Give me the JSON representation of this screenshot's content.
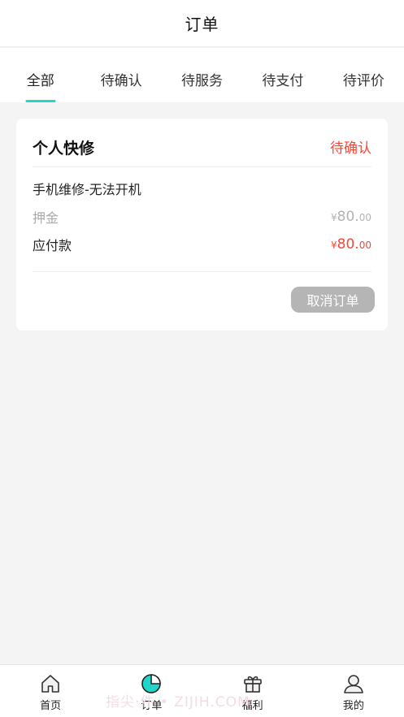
{
  "header": {
    "title": "订单"
  },
  "tabs": [
    {
      "label": "全部",
      "active": true
    },
    {
      "label": "待确认",
      "active": false
    },
    {
      "label": "待服务",
      "active": false
    },
    {
      "label": "待支付",
      "active": false
    },
    {
      "label": "待评价",
      "active": false
    }
  ],
  "order": {
    "title": "个人快修",
    "status": "待确认",
    "service": "手机维修-无法开机",
    "deposit": {
      "label": "押金",
      "currency": "¥",
      "integer": "80.",
      "decimal": "00"
    },
    "payable": {
      "label": "应付款",
      "currency": "¥",
      "integer": "80.",
      "decimal": "00"
    },
    "cancel_label": "取消订单"
  },
  "nav": [
    {
      "label": "首页",
      "icon": "home-icon"
    },
    {
      "label": "订单",
      "icon": "order-pie-icon"
    },
    {
      "label": "福利",
      "icon": "gift-icon"
    },
    {
      "label": "我的",
      "icon": "profile-icon"
    }
  ],
  "watermark": "指尖·件 • ZIJIH.COM",
  "colors": {
    "accent": "#1fd6c8",
    "status_red": "#ef4a3a",
    "button_gray": "#b5b5b5",
    "background": "#f4f4f4"
  }
}
